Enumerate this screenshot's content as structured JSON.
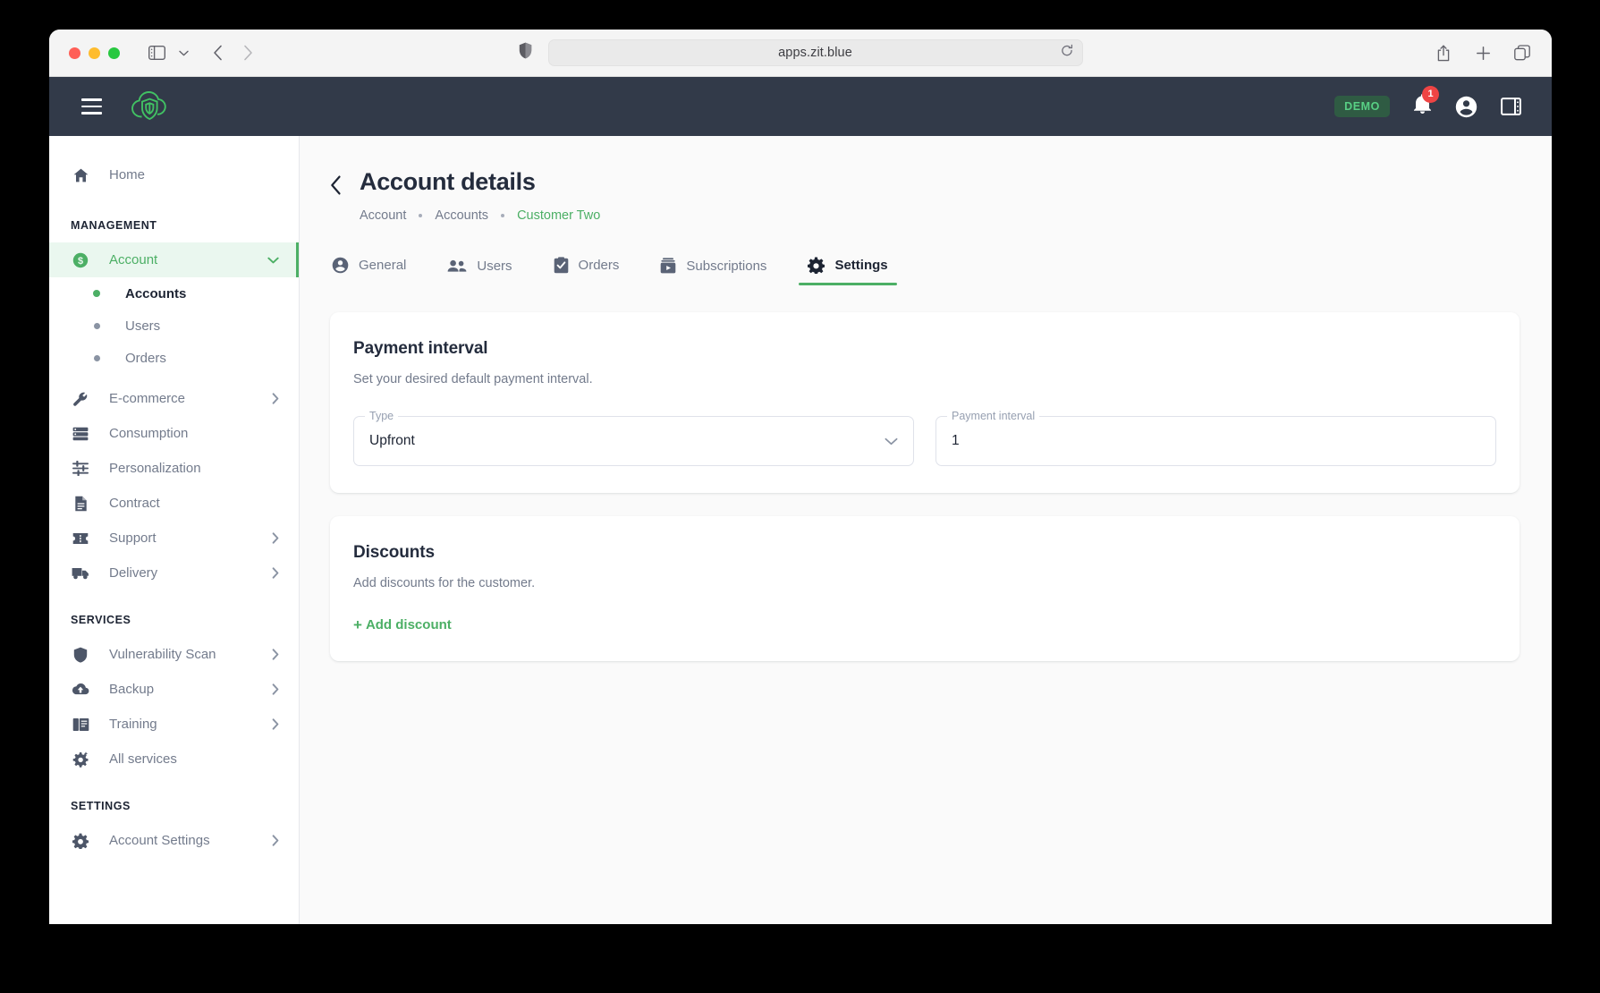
{
  "browser": {
    "url": "apps.zit.blue",
    "icons": {
      "sidebar_toggle": "sidebar-toggle-icon",
      "tab_chevron": "chevron-down-icon",
      "back": "back-arrow-icon",
      "forward": "forward-arrow-icon",
      "shield": "shield-privacy-icon",
      "reload": "reload-icon",
      "share": "share-icon",
      "new_tab": "plus-icon",
      "tab_overview": "tab-overview-icon"
    }
  },
  "app_header": {
    "menu_label": "hamburger-menu",
    "logo_label": "cloud-shield-logo",
    "demo_badge": "DEMO",
    "notification_count": "1",
    "account_icon": "account-circle-icon",
    "panel_icon": "right-panel-icon"
  },
  "sidebar": {
    "home": {
      "label": "Home",
      "icon": "home-icon"
    },
    "sections": [
      {
        "title": "MANAGEMENT",
        "items": [
          {
            "label": "Account",
            "icon": "dollar-circle-icon",
            "active": true,
            "expandable": true,
            "expanded": true,
            "children": [
              {
                "label": "Accounts",
                "active": true
              },
              {
                "label": "Users",
                "active": false
              },
              {
                "label": "Orders",
                "active": false
              }
            ]
          },
          {
            "label": "E-commerce",
            "icon": "wrench-icon",
            "expandable": true
          },
          {
            "label": "Consumption",
            "icon": "list-icon",
            "expandable": false
          },
          {
            "label": "Personalization",
            "icon": "tune-icon",
            "expandable": false
          },
          {
            "label": "Contract",
            "icon": "document-icon",
            "expandable": false
          },
          {
            "label": "Support",
            "icon": "ticket-icon",
            "expandable": true
          },
          {
            "label": "Delivery",
            "icon": "truck-icon",
            "expandable": true
          }
        ]
      },
      {
        "title": "SERVICES",
        "items": [
          {
            "label": "Vulnerability Scan",
            "icon": "shield-icon",
            "expandable": true
          },
          {
            "label": "Backup",
            "icon": "cloud-upload-icon",
            "expandable": true
          },
          {
            "label": "Training",
            "icon": "book-icon",
            "expandable": true
          },
          {
            "label": "All services",
            "icon": "gear-plus-icon",
            "expandable": false
          }
        ]
      },
      {
        "title": "SETTINGS",
        "items": [
          {
            "label": "Account Settings",
            "icon": "gear-icon",
            "expandable": true
          }
        ]
      }
    ]
  },
  "page": {
    "title": "Account details",
    "back_icon": "chevron-left-icon",
    "breadcrumb": [
      {
        "label": "Account",
        "current": false
      },
      {
        "label": "Accounts",
        "current": false
      },
      {
        "label": "Customer Two",
        "current": true
      }
    ]
  },
  "tabs": [
    {
      "label": "General",
      "icon": "person-circle-icon",
      "active": false
    },
    {
      "label": "Users",
      "icon": "people-icon",
      "active": false
    },
    {
      "label": "Orders",
      "icon": "clipboard-check-icon",
      "active": false
    },
    {
      "label": "Subscriptions",
      "icon": "subscriptions-icon",
      "active": false
    },
    {
      "label": "Settings",
      "icon": "gear-icon",
      "active": true
    }
  ],
  "cards": {
    "payment_interval": {
      "title": "Payment interval",
      "description": "Set your desired default payment interval.",
      "type_field": {
        "legend": "Type",
        "value": "Upfront",
        "caret_icon": "chevron-down-icon"
      },
      "interval_field": {
        "legend": "Payment interval",
        "value": "1"
      }
    },
    "discounts": {
      "title": "Discounts",
      "description": "Add discounts for the customer.",
      "add_label": "Add discount",
      "add_plus": "+"
    }
  },
  "colors": {
    "accent_green": "#4caf65",
    "header_dark": "#323a49",
    "text_dark": "#242c3d",
    "text_muted": "#737b8c",
    "badge_red": "#ef4444"
  }
}
